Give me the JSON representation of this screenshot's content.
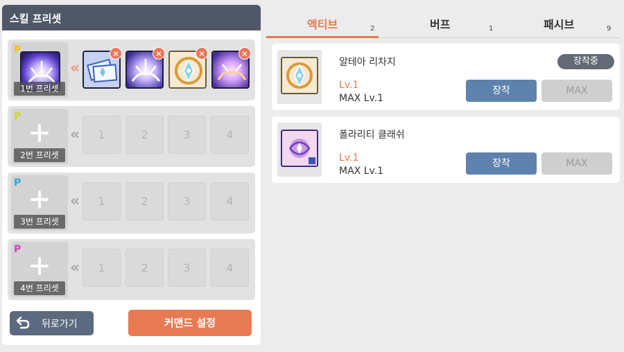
{
  "left_panel": {
    "title": "스킬 프리셋",
    "presets": [
      {
        "label": "1번 프리셋",
        "badge_color": "#f5c400",
        "chevron_color": "#e8937a",
        "filled": true,
        "slots": [
          "",
          "",
          "",
          ""
        ]
      },
      {
        "label": "2번 프리셋",
        "badge_color": "#c9d82c",
        "chevron_color": "#a8a8a8",
        "filled": false,
        "slots": [
          "1",
          "2",
          "3",
          "4"
        ]
      },
      {
        "label": "3번 프리셋",
        "badge_color": "#2aa5d6",
        "chevron_color": "#a8a8a8",
        "filled": false,
        "slots": [
          "1",
          "2",
          "3",
          "4"
        ]
      },
      {
        "label": "4번 프리셋",
        "badge_color": "#d13fb8",
        "chevron_color": "#a8a8a8",
        "filled": false,
        "slots": [
          "1",
          "2",
          "3",
          "4"
        ]
      }
    ],
    "badge_letter": "P",
    "remove_icon": "close-icon",
    "back_button": "뒤로가기",
    "command_button": "커맨드 설정"
  },
  "tabs": [
    {
      "label": "액티브",
      "count": "2",
      "active": true
    },
    {
      "label": "버프",
      "count": "1",
      "active": false
    },
    {
      "label": "패시브",
      "count": "9",
      "active": false
    }
  ],
  "skills": [
    {
      "name": "알테아 리차지",
      "level": "Lv.1",
      "max_level": "MAX Lv.1",
      "equipped_badge": "장착중",
      "equip_button": "장착",
      "max_button": "MAX"
    },
    {
      "name": "폴라리티 클래쉬",
      "level": "Lv.1",
      "max_level": "MAX Lv.1",
      "equip_button": "장착",
      "max_button": "MAX"
    }
  ],
  "colors": {
    "accent": "#e8784f",
    "header_bg": "#4f5866",
    "equip_button": "#5e82ad"
  }
}
